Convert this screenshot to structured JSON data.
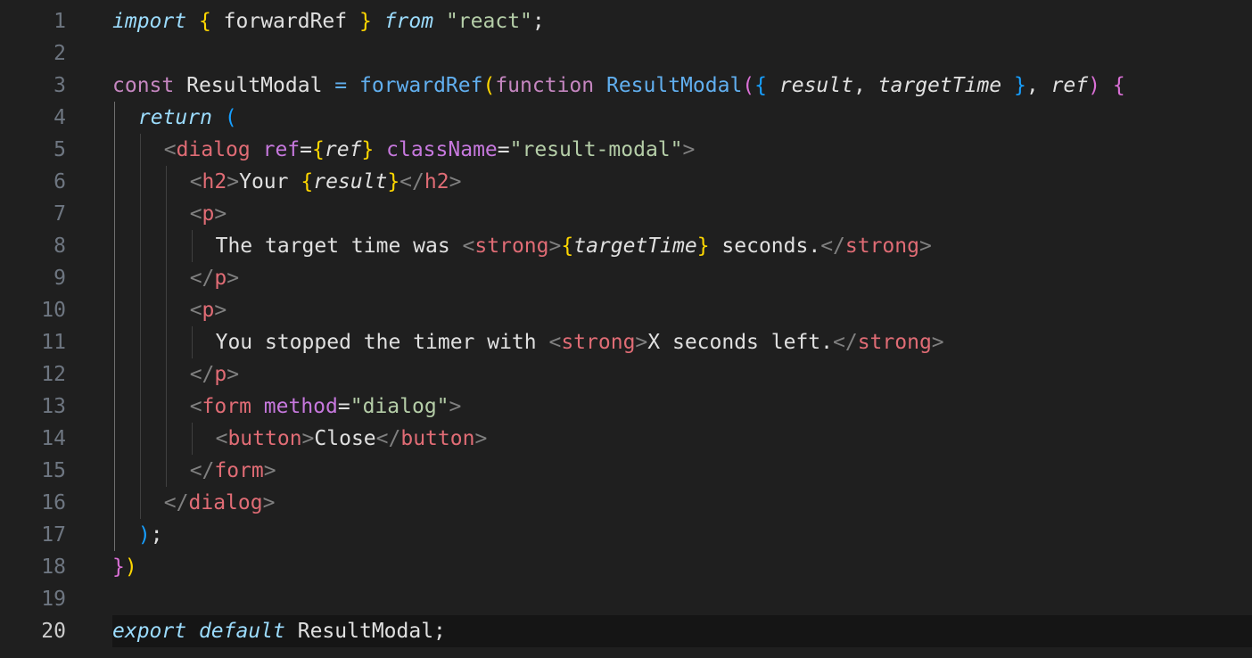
{
  "editor": {
    "current_line": 20,
    "lines": [
      {
        "n": "1",
        "indent": 0,
        "tokens": [
          {
            "t": "import",
            "c": "t-kw-ital"
          },
          {
            "t": " ",
            "c": "t-default"
          },
          {
            "t": "{",
            "c": "t-brace1"
          },
          {
            "t": " forwardRef ",
            "c": "t-default"
          },
          {
            "t": "}",
            "c": "t-brace1"
          },
          {
            "t": " ",
            "c": "t-default"
          },
          {
            "t": "from",
            "c": "t-kw-ital"
          },
          {
            "t": " ",
            "c": "t-default"
          },
          {
            "t": "\"react\"",
            "c": "t-strg"
          },
          {
            "t": ";",
            "c": "t-default"
          }
        ]
      },
      {
        "n": "2",
        "indent": 0,
        "tokens": []
      },
      {
        "n": "3",
        "indent": 0,
        "tokens": [
          {
            "t": "const",
            "c": "t-kw"
          },
          {
            "t": " ResultModal ",
            "c": "t-default"
          },
          {
            "t": "=",
            "c": "t-fn"
          },
          {
            "t": " ",
            "c": "t-default"
          },
          {
            "t": "forwardRef",
            "c": "t-fn"
          },
          {
            "t": "(",
            "c": "t-brace1"
          },
          {
            "t": "function",
            "c": "t-kw"
          },
          {
            "t": " ",
            "c": "t-default"
          },
          {
            "t": "ResultModal",
            "c": "t-fn"
          },
          {
            "t": "(",
            "c": "t-brace2"
          },
          {
            "t": "{",
            "c": "t-brace3"
          },
          {
            "t": " ",
            "c": "t-default"
          },
          {
            "t": "result",
            "c": "t-param"
          },
          {
            "t": ", ",
            "c": "t-default"
          },
          {
            "t": "targetTime",
            "c": "t-param"
          },
          {
            "t": " ",
            "c": "t-default"
          },
          {
            "t": "}",
            "c": "t-brace3"
          },
          {
            "t": ", ",
            "c": "t-default"
          },
          {
            "t": "ref",
            "c": "t-param"
          },
          {
            "t": ")",
            "c": "t-brace2"
          },
          {
            "t": " ",
            "c": "t-default"
          },
          {
            "t": "{",
            "c": "t-brace2"
          }
        ]
      },
      {
        "n": "4",
        "indent": 1,
        "tokens": [
          {
            "t": "return",
            "c": "t-kw-ital"
          },
          {
            "t": " ",
            "c": "t-default"
          },
          {
            "t": "(",
            "c": "t-brace3"
          }
        ]
      },
      {
        "n": "5",
        "indent": 2,
        "tokens": [
          {
            "t": "<",
            "c": "t-angle"
          },
          {
            "t": "dialog",
            "c": "t-tag"
          },
          {
            "t": " ",
            "c": "t-default"
          },
          {
            "t": "ref",
            "c": "t-attr"
          },
          {
            "t": "=",
            "c": "t-default"
          },
          {
            "t": "{",
            "c": "t-brace1"
          },
          {
            "t": "ref",
            "c": "t-param"
          },
          {
            "t": "}",
            "c": "t-brace1"
          },
          {
            "t": " ",
            "c": "t-default"
          },
          {
            "t": "className",
            "c": "t-attr"
          },
          {
            "t": "=",
            "c": "t-default"
          },
          {
            "t": "\"result-modal\"",
            "c": "t-strg"
          },
          {
            "t": ">",
            "c": "t-angle"
          }
        ]
      },
      {
        "n": "6",
        "indent": 3,
        "tokens": [
          {
            "t": "<",
            "c": "t-angle"
          },
          {
            "t": "h2",
            "c": "t-tag"
          },
          {
            "t": ">",
            "c": "t-angle"
          },
          {
            "t": "Your ",
            "c": "t-default"
          },
          {
            "t": "{",
            "c": "t-brace1"
          },
          {
            "t": "result",
            "c": "t-param"
          },
          {
            "t": "}",
            "c": "t-brace1"
          },
          {
            "t": "</",
            "c": "t-angle"
          },
          {
            "t": "h2",
            "c": "t-tag"
          },
          {
            "t": ">",
            "c": "t-angle"
          }
        ]
      },
      {
        "n": "7",
        "indent": 3,
        "tokens": [
          {
            "t": "<",
            "c": "t-angle"
          },
          {
            "t": "p",
            "c": "t-tag"
          },
          {
            "t": ">",
            "c": "t-angle"
          }
        ]
      },
      {
        "n": "8",
        "indent": 4,
        "tokens": [
          {
            "t": "The target time was ",
            "c": "t-default"
          },
          {
            "t": "<",
            "c": "t-angle"
          },
          {
            "t": "strong",
            "c": "t-tag"
          },
          {
            "t": ">",
            "c": "t-angle"
          },
          {
            "t": "{",
            "c": "t-brace1"
          },
          {
            "t": "targetTime",
            "c": "t-param"
          },
          {
            "t": "}",
            "c": "t-brace1"
          },
          {
            "t": " seconds.",
            "c": "t-default"
          },
          {
            "t": "</",
            "c": "t-angle"
          },
          {
            "t": "strong",
            "c": "t-tag"
          },
          {
            "t": ">",
            "c": "t-angle"
          }
        ]
      },
      {
        "n": "9",
        "indent": 3,
        "tokens": [
          {
            "t": "</",
            "c": "t-angle"
          },
          {
            "t": "p",
            "c": "t-tag"
          },
          {
            "t": ">",
            "c": "t-angle"
          }
        ]
      },
      {
        "n": "10",
        "indent": 3,
        "tokens": [
          {
            "t": "<",
            "c": "t-angle"
          },
          {
            "t": "p",
            "c": "t-tag"
          },
          {
            "t": ">",
            "c": "t-angle"
          }
        ]
      },
      {
        "n": "11",
        "indent": 4,
        "tokens": [
          {
            "t": "You stopped the timer with ",
            "c": "t-default"
          },
          {
            "t": "<",
            "c": "t-angle"
          },
          {
            "t": "strong",
            "c": "t-tag"
          },
          {
            "t": ">",
            "c": "t-angle"
          },
          {
            "t": "X seconds left.",
            "c": "t-default"
          },
          {
            "t": "</",
            "c": "t-angle"
          },
          {
            "t": "strong",
            "c": "t-tag"
          },
          {
            "t": ">",
            "c": "t-angle"
          }
        ]
      },
      {
        "n": "12",
        "indent": 3,
        "tokens": [
          {
            "t": "</",
            "c": "t-angle"
          },
          {
            "t": "p",
            "c": "t-tag"
          },
          {
            "t": ">",
            "c": "t-angle"
          }
        ]
      },
      {
        "n": "13",
        "indent": 3,
        "tokens": [
          {
            "t": "<",
            "c": "t-angle"
          },
          {
            "t": "form",
            "c": "t-tag"
          },
          {
            "t": " ",
            "c": "t-default"
          },
          {
            "t": "method",
            "c": "t-attr"
          },
          {
            "t": "=",
            "c": "t-default"
          },
          {
            "t": "\"dialog\"",
            "c": "t-strg"
          },
          {
            "t": ">",
            "c": "t-angle"
          }
        ]
      },
      {
        "n": "14",
        "indent": 4,
        "tokens": [
          {
            "t": "<",
            "c": "t-angle"
          },
          {
            "t": "button",
            "c": "t-tag"
          },
          {
            "t": ">",
            "c": "t-angle"
          },
          {
            "t": "Close",
            "c": "t-default"
          },
          {
            "t": "</",
            "c": "t-angle"
          },
          {
            "t": "button",
            "c": "t-tag"
          },
          {
            "t": ">",
            "c": "t-angle"
          }
        ]
      },
      {
        "n": "15",
        "indent": 3,
        "tokens": [
          {
            "t": "</",
            "c": "t-angle"
          },
          {
            "t": "form",
            "c": "t-tag"
          },
          {
            "t": ">",
            "c": "t-angle"
          }
        ]
      },
      {
        "n": "16",
        "indent": 2,
        "tokens": [
          {
            "t": "</",
            "c": "t-angle"
          },
          {
            "t": "dialog",
            "c": "t-tag"
          },
          {
            "t": ">",
            "c": "t-angle"
          }
        ]
      },
      {
        "n": "17",
        "indent": 1,
        "tokens": [
          {
            "t": ")",
            "c": "t-brace3"
          },
          {
            "t": ";",
            "c": "t-default"
          }
        ]
      },
      {
        "n": "18",
        "indent": 0,
        "tokens": [
          {
            "t": "}",
            "c": "t-brace2"
          },
          {
            "t": ")",
            "c": "t-brace1"
          }
        ]
      },
      {
        "n": "19",
        "indent": 0,
        "tokens": []
      },
      {
        "n": "20",
        "indent": 0,
        "tokens": [
          {
            "t": "export",
            "c": "t-kw-ital"
          },
          {
            "t": " ",
            "c": "t-default"
          },
          {
            "t": "default",
            "c": "t-kw-ital"
          },
          {
            "t": " ResultModal;",
            "c": "t-default"
          }
        ]
      }
    ]
  }
}
